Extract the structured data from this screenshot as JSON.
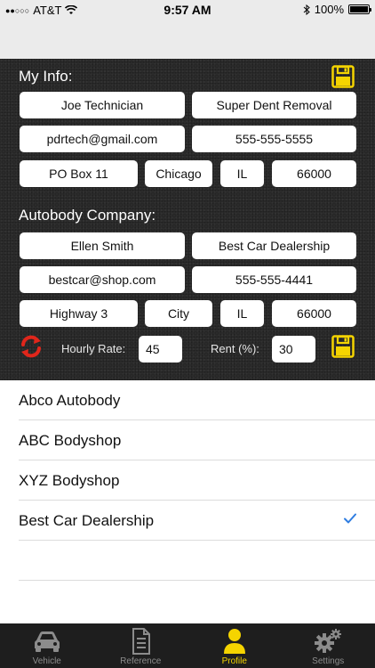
{
  "status": {
    "carrier": "AT&T",
    "time": "9:57 AM",
    "battery": "100%"
  },
  "my_info": {
    "title": "My Info:",
    "name": "Joe Technician",
    "company": "Super Dent Removal",
    "email": "pdrtech@gmail.com",
    "phone": "555-555-5555",
    "address": "PO Box 11",
    "city": "Chicago",
    "state": "IL",
    "zip": "66000"
  },
  "autobody": {
    "title": "Autobody Company:",
    "contact": "Ellen Smith",
    "company": "Best Car Dealership",
    "email": "bestcar@shop.com",
    "phone": "555-555-4441",
    "address": "Highway 3",
    "city": "City",
    "state": "IL",
    "zip": "66000"
  },
  "rates": {
    "hourly_label": "Hourly Rate:",
    "hourly_value": "45",
    "rent_label": "Rent (%):",
    "rent_value": "30"
  },
  "companies": [
    {
      "name": "Abco Autobody",
      "selected": false
    },
    {
      "name": "ABC Bodyshop",
      "selected": false
    },
    {
      "name": "XYZ Bodyshop",
      "selected": false
    },
    {
      "name": "Best Car Dealership",
      "selected": true
    }
  ],
  "tabs": [
    {
      "label": "Vehicle",
      "icon": "car-icon",
      "active": false
    },
    {
      "label": "Reference",
      "icon": "document-icon",
      "active": false
    },
    {
      "label": "Profile",
      "icon": "person-icon",
      "active": true
    },
    {
      "label": "Settings",
      "icon": "gears-icon",
      "active": false
    }
  ],
  "colors": {
    "accent": "#f5d400",
    "refresh": "#e0261b",
    "check": "#2f7de1"
  }
}
